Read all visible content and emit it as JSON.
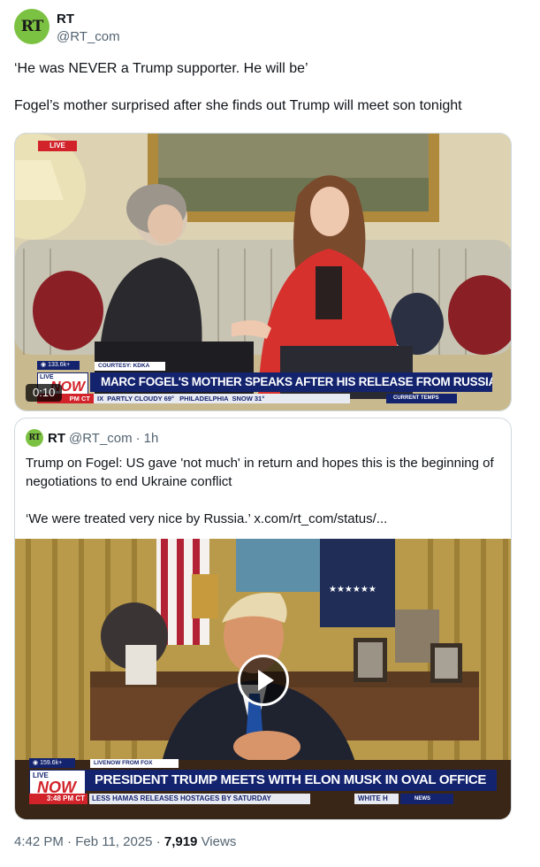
{
  "author": {
    "avatar_text": "RT",
    "name": "RT",
    "handle": "@RT_com"
  },
  "tweet": {
    "text": "‘He was NEVER a Trump supporter. He will be’\n\nFogel’s mother surprised after she finds out Trump will meet son tonight"
  },
  "video1": {
    "live_badge": "LIVE",
    "views": "133.6k+",
    "courtesy": "COURTESY: KDKA",
    "live_small": "LIVE",
    "now": "NOW",
    "headline": "MARC FOGEL'S MOTHER SPEAKS AFTER HIS RELEASE FROM RUSSIAN CUSTODY",
    "time": "PM CT",
    "ticker": "IX  PARTLY CLOUDY 69°   PHILADELPHIA  SNOW 31°",
    "ticker_right": "CURRENT TEMPS",
    "duration": "0:10"
  },
  "quote": {
    "avatar_text": "RT",
    "name": "RT",
    "handle": "@RT_com",
    "dot": "·",
    "time": "1h",
    "text": "Trump on Fogel: US gave 'not much' in return and hopes this is the beginning of negotiations to end Ukraine conflict\n\n‘We were treated very nice by Russia.’ x.com/rt_com/status/..."
  },
  "video2": {
    "views": "159.6k+",
    "source": "LIVENOW FROM FOX",
    "live_small": "LIVE",
    "now": "NOW",
    "headline": "PRESIDENT TRUMP MEETS WITH ELON MUSK IN OVAL OFFICE",
    "time": "3:48 PM CT",
    "ticker": "LESS HAMAS RELEASES HOSTAGES BY SATURDAY",
    "ticker_mid": "WHITE H",
    "ticker_right": "NEWS"
  },
  "footer": {
    "time": "4:42 PM",
    "dot1": "·",
    "date": "Feb 11, 2025",
    "dot2": "·",
    "views_count": "7,919",
    "views_label": "Views"
  },
  "colors": {
    "rt_green": "#7cc242",
    "fox_blue": "#13236e",
    "fox_red": "#d2232a"
  }
}
